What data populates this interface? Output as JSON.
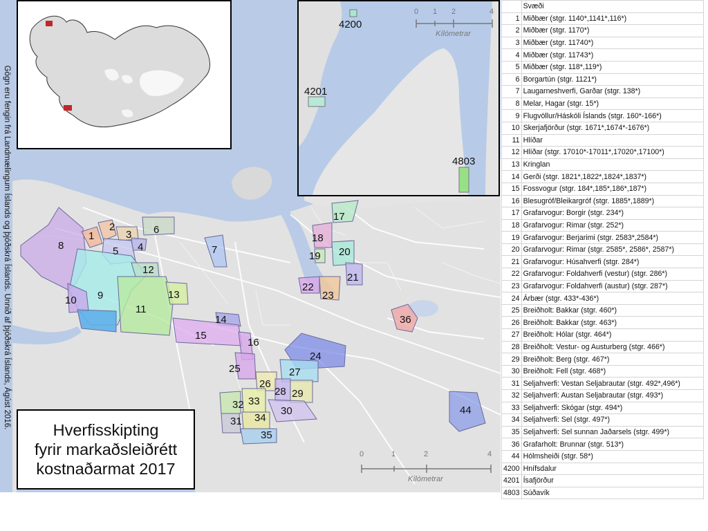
{
  "credit": "Gögn eru fengin frá Landmælingum Íslands og þjóðskrá Íslands. Unnið af þjóðskrá Íslands, Ágúst 2016.",
  "title": [
    "Hverfisskipting",
    "fyrir markaðsleiðrétt",
    "kostnaðarmat 2017"
  ],
  "scale": {
    "ticks": [
      "0",
      "1",
      "2",
      "4"
    ],
    "unit": "Kílómetrar"
  },
  "inset_labels": [
    "4200",
    "4201",
    "4803"
  ],
  "map_labels": [
    "1",
    "2",
    "3",
    "4",
    "5",
    "6",
    "7",
    "8",
    "9",
    "10",
    "11",
    "12",
    "13",
    "14",
    "15",
    "16",
    "17",
    "18",
    "19",
    "20",
    "21",
    "22",
    "23",
    "25",
    "26",
    "27",
    "28",
    "29",
    "30",
    "31",
    "32",
    "33",
    "34",
    "35",
    "36",
    "44",
    "24"
  ],
  "legend": {
    "header": "Svæði",
    "rows": [
      {
        "id": "1",
        "name": "Miðbær (stgr. 1140*,1141*,116*)"
      },
      {
        "id": "2",
        "name": "Miðbær (stgr. 1170*)"
      },
      {
        "id": "3",
        "name": "Miðbær (stgr. 11740*)"
      },
      {
        "id": "4",
        "name": "Miðbær (stgr. 11743*)"
      },
      {
        "id": "5",
        "name": "Miðbær (stgr. 118*,119*)"
      },
      {
        "id": "6",
        "name": "Borgartún (stgr. 1121*)"
      },
      {
        "id": "7",
        "name": "Laugarneshverfi, Garðar (stgr. 138*)"
      },
      {
        "id": "8",
        "name": "Melar, Hagar (stgr. 15*)"
      },
      {
        "id": "9",
        "name": "Flugvöllur/Háskóli Íslands (stgr. 160*-166*)"
      },
      {
        "id": "10",
        "name": "Skerjafjörður (stgr. 1671*,1674*-1676*)"
      },
      {
        "id": "11",
        "name": "Hlíðar"
      },
      {
        "id": "12",
        "name": "Hlíðar (stgr. 17010*-17011*,17020*,17100*)"
      },
      {
        "id": "13",
        "name": "Kringlan"
      },
      {
        "id": "14",
        "name": "Gerði (stgr. 1821*,1822*,1824*,1837*)"
      },
      {
        "id": "15",
        "name": "Fossvogur (stgr. 184*,185*,186*,187*)"
      },
      {
        "id": "16",
        "name": "Blesugróf/Bleikargróf (stgr. 1885*,1889*)"
      },
      {
        "id": "17",
        "name": "Grafarvogur: Borgir (stgr. 234*)"
      },
      {
        "id": "18",
        "name": "Grafarvogur: Rimar (stgr. 252*)"
      },
      {
        "id": "19",
        "name": "Grafarvogur: Berjarimi (stgr. 2583*,2584*)"
      },
      {
        "id": "20",
        "name": "Grafarvogur: Rimar (stgr. 2585*, 2586*, 2587*)"
      },
      {
        "id": "21",
        "name": "Grafarvogur: Húsahverfi (stgr. 284*)"
      },
      {
        "id": "22",
        "name": "Grafarvogur: Foldahverfi (vestur) (stgr. 286*)"
      },
      {
        "id": "23",
        "name": "Grafarvogur: Foldahverfi (austur) (stgr. 287*)"
      },
      {
        "id": "24",
        "name": "Árbær (stgr. 433*-436*)"
      },
      {
        "id": "25",
        "name": "Breiðholt: Bakkar (stgr. 460*)"
      },
      {
        "id": "26",
        "name": "Breiðholt: Bakkar (stgr. 463*)"
      },
      {
        "id": "27",
        "name": "Breiðholt: Hólar (stgr. 464*)"
      },
      {
        "id": "28",
        "name": "Breiðholt: Vestur- og Austurberg (stgr. 466*)"
      },
      {
        "id": "29",
        "name": "Breiðholt: Berg (stgr. 467*)"
      },
      {
        "id": "30",
        "name": "Breiðholt: Fell (stgr. 468*)"
      },
      {
        "id": "31",
        "name": "Seljahverfi: Vestan Seljabrautar (stgr. 492*,496*)"
      },
      {
        "id": "32",
        "name": "Seljahverfi: Austan Seljabrautar (stgr. 493*)"
      },
      {
        "id": "33",
        "name": "Seljahverfi: Skógar (stgr. 494*)"
      },
      {
        "id": "34",
        "name": "Seljahverfi: Sel (stgr. 497*)"
      },
      {
        "id": "35",
        "name": "Seljahverfi: Sel sunnan Jaðarsels (stgr. 499*)"
      },
      {
        "id": "36",
        "name": "Grafarholt: Brunnar (stgr. 513*)"
      },
      {
        "id": "44",
        "name": "Hólmsheiði (stgr. 58*)"
      },
      {
        "id": "4200",
        "name": "Hnífsdalur"
      },
      {
        "id": "4201",
        "name": "Ísafjörður"
      },
      {
        "id": "4803",
        "name": "Súðavík"
      }
    ]
  },
  "colors": {
    "water": "#b9cbe6",
    "land": "#e3e3e3",
    "roads": "#ffffff"
  }
}
